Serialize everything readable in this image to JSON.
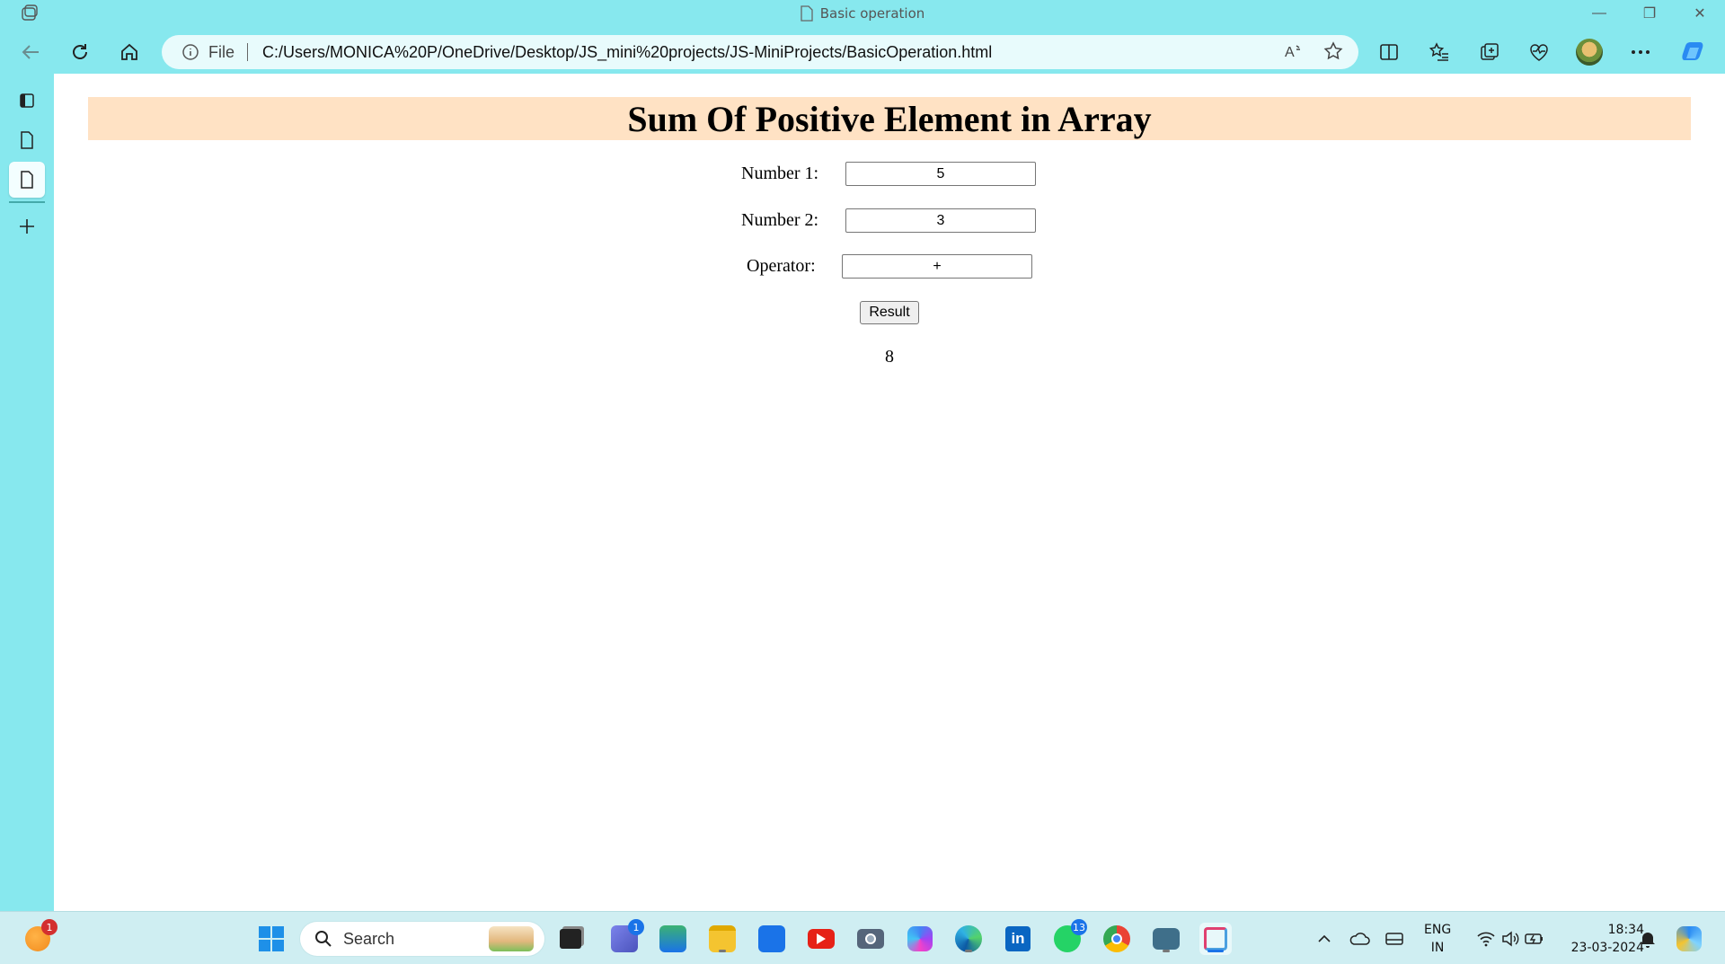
{
  "window": {
    "title": "Basic operation",
    "minimize": "—",
    "restore": "❐",
    "close": "✕"
  },
  "toolbar": {
    "file_label": "File",
    "url": "C:/Users/MONICA%20P/OneDrive/Desktop/JS_mini%20projects/JS-MiniProjects/BasicOperation.html"
  },
  "page": {
    "heading": "Sum Of Positive Element in Array",
    "number1_label": "Number 1:",
    "number1_value": "5",
    "number2_label": "Number 2:",
    "number2_value": "3",
    "operator_label": "Operator:",
    "operator_value": "+",
    "result_button": "Result",
    "result_value": "8"
  },
  "taskbar": {
    "search_placeholder": "Search",
    "weather_badge": "1",
    "teams_badge": "1",
    "whatsapp_badge": "13",
    "lang_line1": "ENG",
    "lang_line2": "IN",
    "time": "18:34",
    "date": "23-03-2024"
  },
  "colors": {
    "chrome_bg": "#87e8ee",
    "heading_band": "#ffe2c4",
    "taskbar_bg": "#cfeef2"
  }
}
